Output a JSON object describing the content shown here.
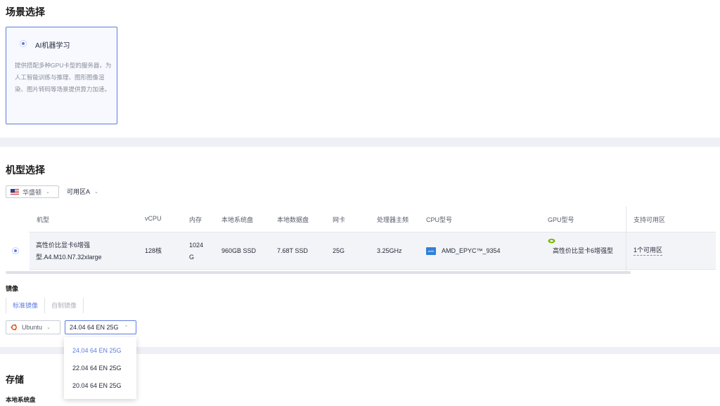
{
  "scene": {
    "title": "场景选择",
    "card_name": "AI机器学习",
    "card_desc": "提供搭配多种GPU卡型的服务器，为人工智能训练与推理、图形图像渲染、图片转码等场景提供算力加速。"
  },
  "model": {
    "title": "机型选择",
    "region": "华盛顿",
    "zone": "可用区A",
    "headers": [
      "机型",
      "vCPU",
      "内存",
      "本地系统盘",
      "本地数据盘",
      "网卡",
      "处理器主频",
      "CPU型号",
      "GPU型号",
      "支持可用区"
    ],
    "row": {
      "name_line1": "高性价比显卡6增强",
      "name_line2": "型.A4.M10.N7.32xlarge",
      "vcpu": "128核",
      "mem_line1": "1024",
      "mem_line2": "G",
      "sys_disk": "960GB SSD",
      "data_disk": "7.68T SSD",
      "nic": "25G",
      "freq": "3.25GHz",
      "cpu_model": "AMD_EPYC™_9354",
      "cpu_logo_text": "AMD",
      "gpu_model": "高性价比显卡6增强型",
      "zones": "1个可用区"
    }
  },
  "image": {
    "title": "镜像",
    "tab_standard": "标准镜像",
    "tab_custom": "自制镜像",
    "os": "Ubuntu",
    "version": "24.04 64 EN 25G",
    "options": [
      "24.04 64 EN 25G",
      "22.04 64 EN 25G",
      "20.04 64 EN 25G"
    ]
  },
  "storage": {
    "title": "存储",
    "sys_disk_label": "本地系统盘"
  },
  "colors": {
    "accent": "#5e7ce0",
    "ubuntu": "#e95420",
    "nvidia": "#76b900",
    "amd": "#2f7fd8"
  }
}
